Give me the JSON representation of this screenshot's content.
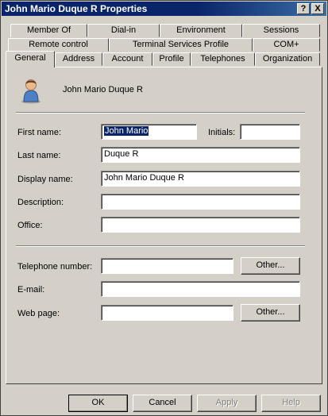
{
  "window": {
    "title": "John Mario Duque R Properties"
  },
  "titlebar_buttons": {
    "help": "?",
    "close": "X"
  },
  "tabs": {
    "row1": [
      "Member Of",
      "Dial-in",
      "Environment",
      "Sessions"
    ],
    "row2": [
      "Remote control",
      "Terminal Services Profile",
      "COM+"
    ],
    "row3": [
      "General",
      "Address",
      "Account",
      "Profile",
      "Telephones",
      "Organization"
    ],
    "active": "General"
  },
  "general": {
    "user_display": "John Mario Duque R",
    "labels": {
      "first_name": "First name:",
      "initials": "Initials:",
      "last_name": "Last name:",
      "display_name": "Display name:",
      "description": "Description:",
      "office": "Office:",
      "telephone": "Telephone number:",
      "email": "E-mail:",
      "web_page": "Web page:"
    },
    "values": {
      "first_name": "John Mario",
      "initials": "",
      "last_name": "Duque R",
      "display_name": "John Mario Duque R",
      "description": "",
      "office": "",
      "telephone": "",
      "email": "",
      "web_page": ""
    },
    "other_button": "Other..."
  },
  "footer": {
    "ok": "OK",
    "cancel": "Cancel",
    "apply": "Apply",
    "help": "Help"
  },
  "colors": {
    "titlebar": "#0a246a",
    "face": "#d4d0c8",
    "selection": "#0a246a"
  }
}
